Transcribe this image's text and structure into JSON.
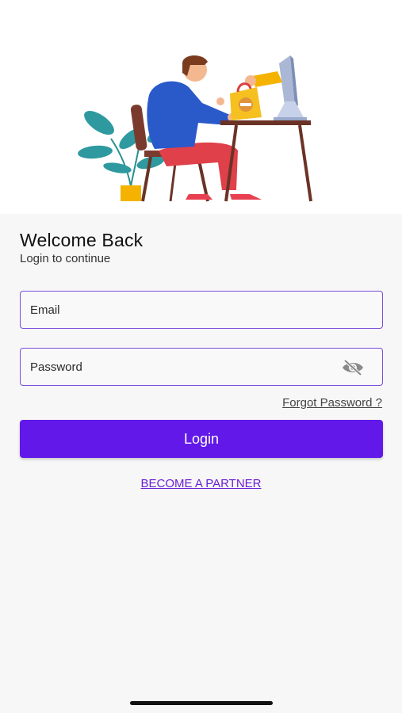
{
  "header": {
    "title": "Welcome Back",
    "subtitle": "Login to continue"
  },
  "form": {
    "email_placeholder": "Email",
    "password_placeholder": "Password",
    "password_toggle_icon": "eye-slash-icon",
    "forgot_password_label": "Forgot Password ?",
    "login_button_label": "Login",
    "become_partner_label": "BECOME A PARTNER"
  },
  "colors": {
    "accent": "#6218e8",
    "field_border": "#7a4cdb",
    "link": "#6a1fd6",
    "background": "#f7f7f7"
  }
}
